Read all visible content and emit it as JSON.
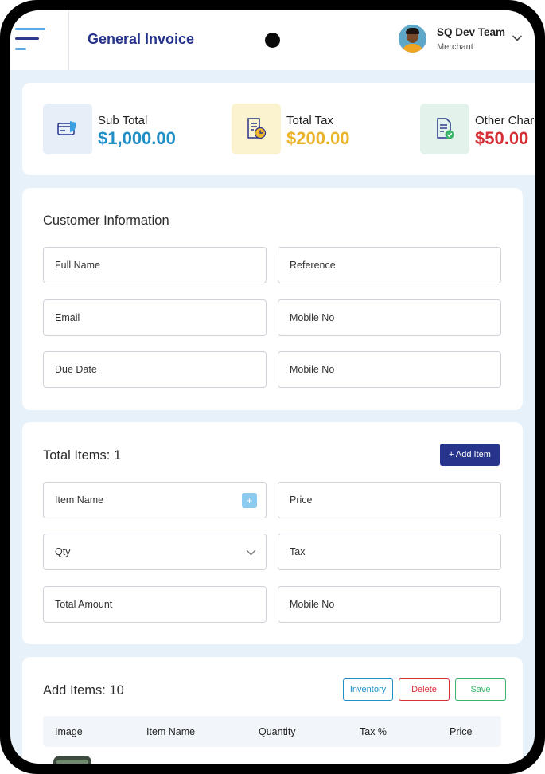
{
  "header": {
    "title": "General Invoice",
    "user_name": "SQ Dev Team",
    "user_role": "Merchant"
  },
  "summary": [
    {
      "label": "Sub Total",
      "value": "$1,000.00",
      "color": "#1f8fc6",
      "icon": "card-shield-icon",
      "icon_bg": "#e6eef8"
    },
    {
      "label": "Total Tax",
      "value": "$200.00",
      "color": "#e9b42a",
      "icon": "receipt-clock-icon",
      "icon_bg": "#fbf3d0"
    },
    {
      "label": "Other Charges",
      "value": "$50.00",
      "color": "#d62f35",
      "icon": "document-check-icon",
      "icon_bg": "#e3f2ea"
    }
  ],
  "customer": {
    "title": "Customer Information",
    "fields": [
      "Full Name",
      "Reference",
      "Email",
      "Mobile No",
      "Due Date",
      "Mobile No"
    ]
  },
  "items_form": {
    "title": "Total Items: 1",
    "add_button": "+ Add Item",
    "fields": [
      "Item Name",
      "Price",
      "Qty",
      "Tax",
      "Total Amount",
      "Mobile No"
    ]
  },
  "items_list": {
    "title": "Add Items: 10",
    "buttons": {
      "inventory": "Inventory",
      "delete": "Delete",
      "save": "Save"
    },
    "columns": [
      "Image",
      "Item Name",
      "Quantity",
      "Tax %",
      "Price"
    ]
  }
}
